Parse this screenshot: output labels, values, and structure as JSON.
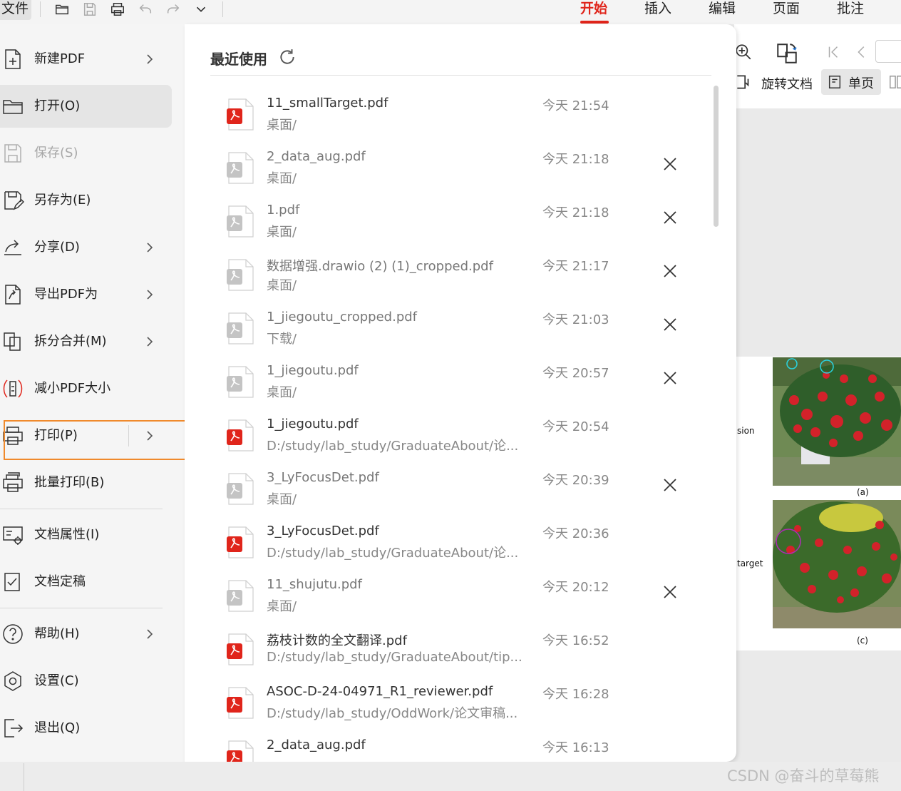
{
  "topbar": {
    "file_label": "文件",
    "tabs": [
      {
        "label": "开始",
        "active": true
      },
      {
        "label": "插入",
        "active": false
      },
      {
        "label": "编辑",
        "active": false
      },
      {
        "label": "页面",
        "active": false
      },
      {
        "label": "批注",
        "active": false
      }
    ],
    "quick_actions": [
      "open-folder-icon",
      "save-icon",
      "print-icon",
      "undo-icon",
      "redo-icon",
      "more-icon"
    ]
  },
  "ribbon": {
    "rotate_label": "旋转文档",
    "single_page_label": "单页"
  },
  "preview": {
    "caption_a": "(a)",
    "caption_c": "(c)",
    "side_text_1": "sion",
    "side_text_2": "target"
  },
  "menu": {
    "items": [
      {
        "label": "新建PDF",
        "icon": "new-pdf-icon",
        "has_submenu": true
      },
      {
        "label": "打开(O)",
        "icon": "open-folder-icon",
        "selected": true
      },
      {
        "label": "保存(S)",
        "icon": "save-icon",
        "disabled": true
      },
      {
        "label": "另存为(E)",
        "icon": "save-as-icon"
      },
      {
        "label": "分享(D)",
        "icon": "share-icon",
        "has_submenu": true
      },
      {
        "label": "导出PDF为",
        "icon": "export-pdf-icon",
        "has_submenu": true
      },
      {
        "label": "拆分合并(M)",
        "icon": "split-merge-icon",
        "has_submenu": true
      },
      {
        "label": "减小PDF大小",
        "icon": "compress-icon"
      },
      {
        "label": "打印(P)",
        "icon": "print-icon",
        "has_submenu": true,
        "highlighted": true
      },
      {
        "label": "批量打印(B)",
        "icon": "batch-print-icon"
      },
      {
        "label": "文档属性(I)",
        "icon": "doc-properties-icon"
      },
      {
        "label": "文档定稿",
        "icon": "finalize-icon"
      },
      {
        "label": "帮助(H)",
        "icon": "help-icon",
        "has_submenu": true
      },
      {
        "label": "设置(C)",
        "icon": "settings-icon"
      },
      {
        "label": "退出(Q)",
        "icon": "exit-icon"
      }
    ]
  },
  "recent": {
    "title": "最近使用",
    "files": [
      {
        "name": "11_smallTarget.pdf",
        "path": "桌面/",
        "time": "今天 21:54",
        "active": true,
        "removable": false
      },
      {
        "name": "2_data_aug.pdf",
        "path": "桌面/",
        "time": "今天 21:18",
        "active": false,
        "removable": true
      },
      {
        "name": "1.pdf",
        "path": "桌面/",
        "time": "今天 21:18",
        "active": false,
        "removable": true
      },
      {
        "name": "数据增强.drawio (2) (1)_cropped.pdf",
        "path": "桌面/",
        "time": "今天 21:17",
        "active": false,
        "removable": true
      },
      {
        "name": "1_jiegoutu_cropped.pdf",
        "path": "下载/",
        "time": "今天 21:03",
        "active": false,
        "removable": true
      },
      {
        "name": "1_jiegoutu.pdf",
        "path": "桌面/",
        "time": "今天 20:57",
        "active": false,
        "removable": true
      },
      {
        "name": "1_jiegoutu.pdf",
        "path": "D:/study/lab_study/GraduateAbout/论...",
        "time": "今天 20:54",
        "active": true,
        "removable": false
      },
      {
        "name": "3_LyFocusDet.pdf",
        "path": "桌面/",
        "time": "今天 20:39",
        "active": false,
        "removable": true
      },
      {
        "name": "3_LyFocusDet.pdf",
        "path": "D:/study/lab_study/GraduateAbout/论...",
        "time": "今天 20:36",
        "active": true,
        "removable": false
      },
      {
        "name": "11_shujutu.pdf",
        "path": "桌面/",
        "time": "今天 20:12",
        "active": false,
        "removable": true
      },
      {
        "name": "荔枝计数的全文翻译.pdf",
        "path": "D:/study/lab_study/GraduateAbout/tip...",
        "time": "今天 16:52",
        "active": true,
        "removable": false
      },
      {
        "name": "ASOC-D-24-04971_R1_reviewer.pdf",
        "path": "D:/study/lab_study/OddWork/论文审稿...",
        "time": "今天 16:28",
        "active": true,
        "removable": false
      },
      {
        "name": "2_data_aug.pdf",
        "path": "",
        "time": "今天 16:13",
        "active": true,
        "removable": false
      }
    ]
  },
  "watermark": "CSDN @奋斗的草莓熊",
  "colors": {
    "accent": "#e0251b",
    "highlight_border": "#f08a2c",
    "pdf_icon_active": "#e0251b",
    "pdf_icon_faded": "#c4c4c4"
  }
}
